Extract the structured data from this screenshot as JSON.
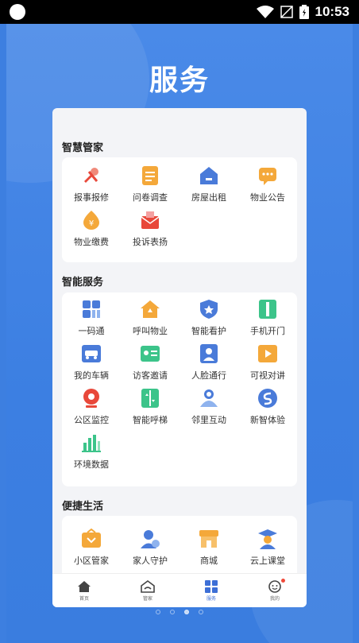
{
  "status_bar": {
    "time": "10:53"
  },
  "page": {
    "title": "服务"
  },
  "sections": [
    {
      "title": "智慧管家",
      "items": [
        {
          "label": "报事报修",
          "icon": "wrench-screwdriver-icon"
        },
        {
          "label": "问卷调查",
          "icon": "questionnaire-icon"
        },
        {
          "label": "房屋出租",
          "icon": "house-rent-icon"
        },
        {
          "label": "物业公告",
          "icon": "announcement-icon"
        },
        {
          "label": "物业缴费",
          "icon": "payment-icon"
        },
        {
          "label": "投诉表扬",
          "icon": "complaint-mailbox-icon"
        }
      ]
    },
    {
      "title": "智能服务",
      "items": [
        {
          "label": "一码通",
          "icon": "qr-code-icon"
        },
        {
          "label": "呼叫物业",
          "icon": "call-property-icon"
        },
        {
          "label": "智能看护",
          "icon": "shield-care-icon"
        },
        {
          "label": "手机开门",
          "icon": "door-open-icon"
        },
        {
          "label": "我的车辆",
          "icon": "car-icon"
        },
        {
          "label": "访客邀请",
          "icon": "visitor-card-icon"
        },
        {
          "label": "人脸通行",
          "icon": "face-pass-icon"
        },
        {
          "label": "可视对讲",
          "icon": "video-intercom-icon"
        },
        {
          "label": "公区监控",
          "icon": "camera-icon"
        },
        {
          "label": "智能呼梯",
          "icon": "elevator-icon"
        },
        {
          "label": "邻里互动",
          "icon": "neighbor-icon"
        },
        {
          "label": "新智体验",
          "icon": "experience-icon"
        },
        {
          "label": "环境数据",
          "icon": "environment-chart-icon"
        }
      ]
    },
    {
      "title": "便捷生活",
      "items": [
        {
          "label": "小区管家",
          "icon": "butler-icon"
        },
        {
          "label": "家人守护",
          "icon": "family-guard-icon"
        },
        {
          "label": "商城",
          "icon": "shop-icon"
        },
        {
          "label": "云上课堂",
          "icon": "online-class-icon"
        }
      ]
    }
  ],
  "tabbar": [
    {
      "label": "首页",
      "icon": "home-icon",
      "active": false
    },
    {
      "label": "管家",
      "icon": "butler-tab-icon",
      "active": false
    },
    {
      "label": "服务",
      "icon": "service-grid-icon",
      "active": true
    },
    {
      "label": "我的",
      "icon": "profile-icon",
      "active": false,
      "badge": true
    }
  ],
  "pager": {
    "count": 4,
    "active": 2
  },
  "colors": {
    "background": "#3d7fe0",
    "accent": "#4a7bd9",
    "orange": "#f39a2b",
    "red": "#e8483a",
    "green": "#3cc48a"
  }
}
